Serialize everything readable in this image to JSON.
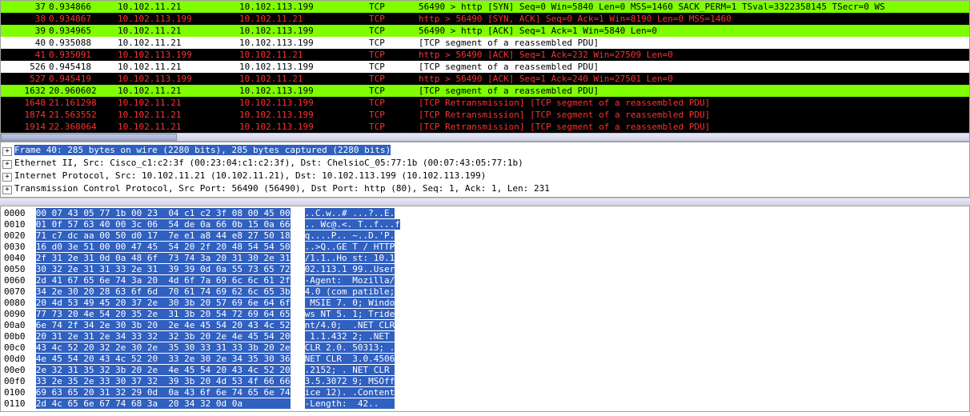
{
  "packets": [
    {
      "cls": "row-green",
      "no": "37",
      "time": "0.934866",
      "src": "10.102.11.21",
      "dst": "10.102.113.199",
      "proto": "TCP",
      "info": "56490 > http [SYN] Seq=0 Win=5840 Len=0 MSS=1460 SACK_PERM=1 TSval=3322358145 TSecr=0 WS"
    },
    {
      "cls": "row-black",
      "no": "38",
      "time": "0.934867",
      "src": "10.102.113.199",
      "dst": "10.102.11.21",
      "proto": "TCP",
      "info": "http > 56490 [SYN, ACK] Seq=0 Ack=1 Win=8190 Len=0 MSS=1460"
    },
    {
      "cls": "row-green",
      "no": "39",
      "time": "0.934965",
      "src": "10.102.11.21",
      "dst": "10.102.113.199",
      "proto": "TCP",
      "info": "56490 > http [ACK] Seq=1 Ack=1 Win=5840 Len=0"
    },
    {
      "cls": "row-white",
      "no": "40",
      "time": "0.935088",
      "src": "10.102.11.21",
      "dst": "10.102.113.199",
      "proto": "TCP",
      "info": "[TCP segment of a reassembled PDU]"
    },
    {
      "cls": "row-black",
      "no": "41",
      "time": "0.935091",
      "src": "10.102.113.199",
      "dst": "10.102.11.21",
      "proto": "TCP",
      "info": "http > 56490 [ACK] Seq=1 Ack=232 Win=27509 Len=0"
    },
    {
      "cls": "row-white",
      "no": "526",
      "time": "0.945418",
      "src": "10.102.11.21",
      "dst": "10.102.113.199",
      "proto": "TCP",
      "info": "[TCP segment of a reassembled PDU]"
    },
    {
      "cls": "row-black",
      "no": "527",
      "time": "0.945419",
      "src": "10.102.113.199",
      "dst": "10.102.11.21",
      "proto": "TCP",
      "info": "http > 56490 [ACK] Seq=1 Ack=240 Win=27501 Len=0"
    },
    {
      "cls": "row-green",
      "no": "1632",
      "time": "20.960602",
      "src": "10.102.11.21",
      "dst": "10.102.113.199",
      "proto": "TCP",
      "info": "[TCP segment of a reassembled PDU]"
    },
    {
      "cls": "row-black",
      "no": "1648",
      "time": "21.161298",
      "src": "10.102.11.21",
      "dst": "10.102.113.199",
      "proto": "TCP",
      "info": "[TCP Retransmission] [TCP segment of a reassembled PDU]"
    },
    {
      "cls": "row-black",
      "no": "1874",
      "time": "21.563552",
      "src": "10.102.11.21",
      "dst": "10.102.113.199",
      "proto": "TCP",
      "info": "[TCP Retransmission] [TCP segment of a reassembled PDU]"
    },
    {
      "cls": "row-black",
      "no": "1914",
      "time": "22.368064",
      "src": "10.102.11.21",
      "dst": "10.102.113.199",
      "proto": "TCP",
      "info": "[TCP Retransmission] [TCP segment of a reassembled PDU]"
    }
  ],
  "details": {
    "l0": "Frame 40: 285 bytes on wire (2280 bits), 285 bytes captured (2280 bits)",
    "l1": "Ethernet II, Src: Cisco_c1:c2:3f (00:23:04:c1:c2:3f), Dst: ChelsioC_05:77:1b (00:07:43:05:77:1b)",
    "l2": "Internet Protocol, Src: 10.102.11.21 (10.102.11.21), Dst: 10.102.113.199 (10.102.113.199)",
    "l3": "Transmission Control Protocol, Src Port: 56490 (56490), Dst Port: http (80), Seq: 1, Ack: 1, Len: 231"
  },
  "hex": [
    {
      "off": "0000",
      "b": "00 07 43 05 77 1b 00 23  04 c1 c2 3f 08 00 45 00",
      "a": "..C.w..# ...?..E."
    },
    {
      "off": "0010",
      "b": "01 0f 57 63 40 00 3c 06  54 de 0a 66 0b 15 0a 66",
      "a": ".. Wc@.<. T..f...f"
    },
    {
      "off": "0020",
      "b": "71 c7 dc aa 00 50 d0 17  7e e1 a8 44 e8 27 50 18",
      "a": "q....P.. ~..D.'P."
    },
    {
      "off": "0030",
      "b": "16 d0 3e 51 00 00 47 45  54 20 2f 20 48 54 54 50",
      "a": "..>Q..GE T / HTTP"
    },
    {
      "off": "0040",
      "b": "2f 31 2e 31 0d 0a 48 6f  73 74 3a 20 31 30 2e 31",
      "a": "/1.1..Ho st: 10.1"
    },
    {
      "off": "0050",
      "b": "30 32 2e 31 31 33 2e 31  39 39 0d 0a 55 73 65 72",
      "a": "02.113.1 99..User"
    },
    {
      "off": "0060",
      "b": "2d 41 67 65 6e 74 3a 20  4d 6f 7a 69 6c 6c 61 2f",
      "a": "-Agent:  Mozilla/"
    },
    {
      "off": "0070",
      "b": "34 2e 30 20 28 63 6f 6d  70 61 74 69 62 6c 65 3b",
      "a": "4.0 (com patible;"
    },
    {
      "off": "0080",
      "b": "20 4d 53 49 45 20 37 2e  30 3b 20 57 69 6e 64 6f",
      "a": " MSIE 7. 0; Windo"
    },
    {
      "off": "0090",
      "b": "77 73 20 4e 54 20 35 2e  31 3b 20 54 72 69 64 65",
      "a": "ws NT 5. 1; Tride"
    },
    {
      "off": "00a0",
      "b": "6e 74 2f 34 2e 30 3b 20  2e 4e 45 54 20 43 4c 52",
      "a": "nt/4.0;  .NET CLR"
    },
    {
      "off": "00b0",
      "b": "20 31 2e 31 2e 34 33 32  32 3b 20 2e 4e 45 54 20",
      "a": " 1.1.432 2; .NET "
    },
    {
      "off": "00c0",
      "b": "43 4c 52 20 32 2e 30 2e  35 30 33 31 33 3b 20 2e",
      "a": "CLR 2.0. 50313; ."
    },
    {
      "off": "00d0",
      "b": "4e 45 54 20 43 4c 52 20  33 2e 30 2e 34 35 30 36",
      "a": "NET CLR  3.0.4506"
    },
    {
      "off": "00e0",
      "b": "2e 32 31 35 32 3b 20 2e  4e 45 54 20 43 4c 52 20",
      "a": ".2152; . NET CLR "
    },
    {
      "off": "00f0",
      "b": "33 2e 35 2e 33 30 37 32  39 3b 20 4d 53 4f 66 66",
      "a": "3.5.3072 9; MSOff"
    },
    {
      "off": "0100",
      "b": "69 63 65 20 31 32 29 0d  0a 43 6f 6e 74 65 6e 74",
      "a": "ice 12). .Content"
    },
    {
      "off": "0110",
      "b": "2d 4c 65 6e 67 74 68 3a  20 34 32 0d 0a         ",
      "a": "-Length:  42..   "
    }
  ]
}
